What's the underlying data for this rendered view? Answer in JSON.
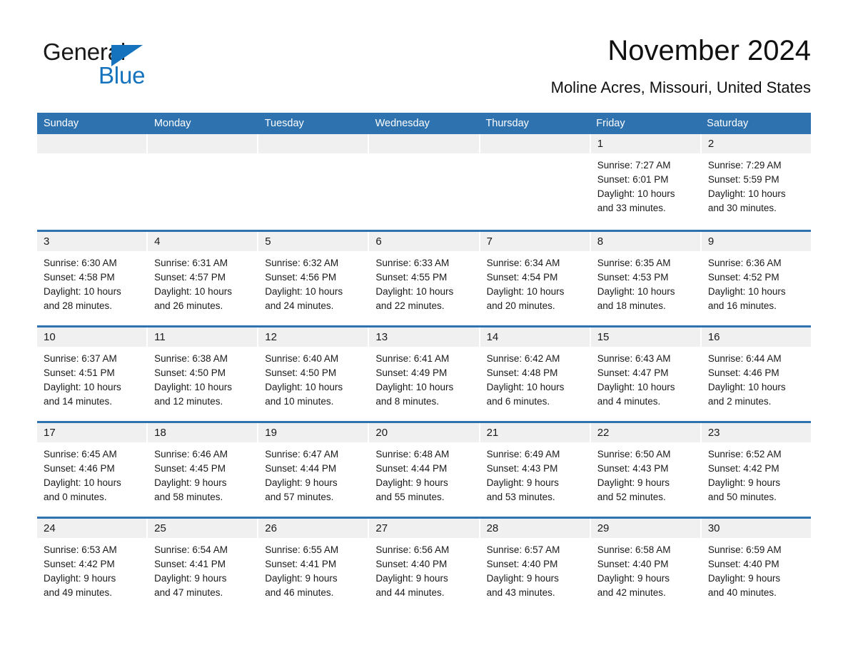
{
  "brand": {
    "name_part1": "General",
    "name_part2": "Blue",
    "triangle_icon": "blue-triangle-logo-mark",
    "accent_color": "#1573BE"
  },
  "header": {
    "title": "November 2024",
    "subtitle": "Moline Acres, Missouri, United States"
  },
  "theme": {
    "header_blue": "#2E72B0",
    "day_band_gray": "#F0F0F0",
    "cell_background": "#FFFFFF",
    "text_color": "#1A1A1A"
  },
  "weekdays": [
    "Sunday",
    "Monday",
    "Tuesday",
    "Wednesday",
    "Thursday",
    "Friday",
    "Saturday"
  ],
  "weeks": [
    [
      {
        "day": "",
        "lines": []
      },
      {
        "day": "",
        "lines": []
      },
      {
        "day": "",
        "lines": []
      },
      {
        "day": "",
        "lines": []
      },
      {
        "day": "",
        "lines": []
      },
      {
        "day": "1",
        "lines": [
          "Sunrise: 7:27 AM",
          "Sunset: 6:01 PM",
          "Daylight: 10 hours",
          "and 33 minutes."
        ]
      },
      {
        "day": "2",
        "lines": [
          "Sunrise: 7:29 AM",
          "Sunset: 5:59 PM",
          "Daylight: 10 hours",
          "and 30 minutes."
        ]
      }
    ],
    [
      {
        "day": "3",
        "lines": [
          "Sunrise: 6:30 AM",
          "Sunset: 4:58 PM",
          "Daylight: 10 hours",
          "and 28 minutes."
        ]
      },
      {
        "day": "4",
        "lines": [
          "Sunrise: 6:31 AM",
          "Sunset: 4:57 PM",
          "Daylight: 10 hours",
          "and 26 minutes."
        ]
      },
      {
        "day": "5",
        "lines": [
          "Sunrise: 6:32 AM",
          "Sunset: 4:56 PM",
          "Daylight: 10 hours",
          "and 24 minutes."
        ]
      },
      {
        "day": "6",
        "lines": [
          "Sunrise: 6:33 AM",
          "Sunset: 4:55 PM",
          "Daylight: 10 hours",
          "and 22 minutes."
        ]
      },
      {
        "day": "7",
        "lines": [
          "Sunrise: 6:34 AM",
          "Sunset: 4:54 PM",
          "Daylight: 10 hours",
          "and 20 minutes."
        ]
      },
      {
        "day": "8",
        "lines": [
          "Sunrise: 6:35 AM",
          "Sunset: 4:53 PM",
          "Daylight: 10 hours",
          "and 18 minutes."
        ]
      },
      {
        "day": "9",
        "lines": [
          "Sunrise: 6:36 AM",
          "Sunset: 4:52 PM",
          "Daylight: 10 hours",
          "and 16 minutes."
        ]
      }
    ],
    [
      {
        "day": "10",
        "lines": [
          "Sunrise: 6:37 AM",
          "Sunset: 4:51 PM",
          "Daylight: 10 hours",
          "and 14 minutes."
        ]
      },
      {
        "day": "11",
        "lines": [
          "Sunrise: 6:38 AM",
          "Sunset: 4:50 PM",
          "Daylight: 10 hours",
          "and 12 minutes."
        ]
      },
      {
        "day": "12",
        "lines": [
          "Sunrise: 6:40 AM",
          "Sunset: 4:50 PM",
          "Daylight: 10 hours",
          "and 10 minutes."
        ]
      },
      {
        "day": "13",
        "lines": [
          "Sunrise: 6:41 AM",
          "Sunset: 4:49 PM",
          "Daylight: 10 hours",
          "and 8 minutes."
        ]
      },
      {
        "day": "14",
        "lines": [
          "Sunrise: 6:42 AM",
          "Sunset: 4:48 PM",
          "Daylight: 10 hours",
          "and 6 minutes."
        ]
      },
      {
        "day": "15",
        "lines": [
          "Sunrise: 6:43 AM",
          "Sunset: 4:47 PM",
          "Daylight: 10 hours",
          "and 4 minutes."
        ]
      },
      {
        "day": "16",
        "lines": [
          "Sunrise: 6:44 AM",
          "Sunset: 4:46 PM",
          "Daylight: 10 hours",
          "and 2 minutes."
        ]
      }
    ],
    [
      {
        "day": "17",
        "lines": [
          "Sunrise: 6:45 AM",
          "Sunset: 4:46 PM",
          "Daylight: 10 hours",
          "and 0 minutes."
        ]
      },
      {
        "day": "18",
        "lines": [
          "Sunrise: 6:46 AM",
          "Sunset: 4:45 PM",
          "Daylight: 9 hours",
          "and 58 minutes."
        ]
      },
      {
        "day": "19",
        "lines": [
          "Sunrise: 6:47 AM",
          "Sunset: 4:44 PM",
          "Daylight: 9 hours",
          "and 57 minutes."
        ]
      },
      {
        "day": "20",
        "lines": [
          "Sunrise: 6:48 AM",
          "Sunset: 4:44 PM",
          "Daylight: 9 hours",
          "and 55 minutes."
        ]
      },
      {
        "day": "21",
        "lines": [
          "Sunrise: 6:49 AM",
          "Sunset: 4:43 PM",
          "Daylight: 9 hours",
          "and 53 minutes."
        ]
      },
      {
        "day": "22",
        "lines": [
          "Sunrise: 6:50 AM",
          "Sunset: 4:43 PM",
          "Daylight: 9 hours",
          "and 52 minutes."
        ]
      },
      {
        "day": "23",
        "lines": [
          "Sunrise: 6:52 AM",
          "Sunset: 4:42 PM",
          "Daylight: 9 hours",
          "and 50 minutes."
        ]
      }
    ],
    [
      {
        "day": "24",
        "lines": [
          "Sunrise: 6:53 AM",
          "Sunset: 4:42 PM",
          "Daylight: 9 hours",
          "and 49 minutes."
        ]
      },
      {
        "day": "25",
        "lines": [
          "Sunrise: 6:54 AM",
          "Sunset: 4:41 PM",
          "Daylight: 9 hours",
          "and 47 minutes."
        ]
      },
      {
        "day": "26",
        "lines": [
          "Sunrise: 6:55 AM",
          "Sunset: 4:41 PM",
          "Daylight: 9 hours",
          "and 46 minutes."
        ]
      },
      {
        "day": "27",
        "lines": [
          "Sunrise: 6:56 AM",
          "Sunset: 4:40 PM",
          "Daylight: 9 hours",
          "and 44 minutes."
        ]
      },
      {
        "day": "28",
        "lines": [
          "Sunrise: 6:57 AM",
          "Sunset: 4:40 PM",
          "Daylight: 9 hours",
          "and 43 minutes."
        ]
      },
      {
        "day": "29",
        "lines": [
          "Sunrise: 6:58 AM",
          "Sunset: 4:40 PM",
          "Daylight: 9 hours",
          "and 42 minutes."
        ]
      },
      {
        "day": "30",
        "lines": [
          "Sunrise: 6:59 AM",
          "Sunset: 4:40 PM",
          "Daylight: 9 hours",
          "and 40 minutes."
        ]
      }
    ]
  ]
}
